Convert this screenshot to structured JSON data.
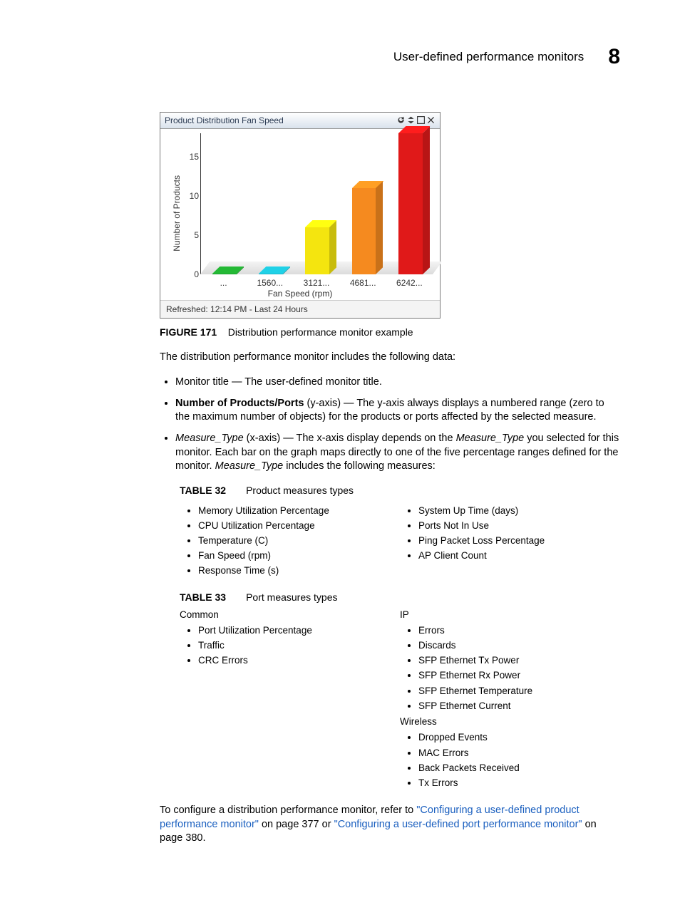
{
  "header": {
    "title": "User-defined performance monitors",
    "chapter": "8"
  },
  "panel": {
    "title": "Product Distribution Fan Speed",
    "footer": "Refreshed: 12:14 PM -  Last 24 Hours",
    "ylabel": "Number of Products",
    "xlabel": "Fan Speed (rpm)",
    "yticks": [
      "0",
      "5",
      "10",
      "15"
    ],
    "xticks": [
      "...",
      "1560...",
      "3121...",
      "4681...",
      "6242..."
    ],
    "icons": [
      "refresh-icon",
      "collapse-icon",
      "maximize-icon",
      "close-icon"
    ]
  },
  "chart_data": {
    "type": "bar",
    "title": "Product Distribution Fan Speed",
    "xlabel": "Fan Speed (rpm)",
    "ylabel": "Number of Products",
    "ylim": [
      0,
      18
    ],
    "categories": [
      "...",
      "1560...",
      "3121...",
      "4681...",
      "6242..."
    ],
    "values": [
      0,
      0,
      6,
      11,
      18
    ],
    "colors": [
      "#1fa12e",
      "#1bb6c9",
      "#f4e50f",
      "#f58a1f",
      "#e01919"
    ]
  },
  "figure": {
    "label": "FIGURE 171",
    "title": "Distribution performance monitor example"
  },
  "para_intro": "The distribution performance monitor includes the following data:",
  "bullets": {
    "b1_lead": "Monitor title — ",
    "b1_rest": "The user-defined monitor title.",
    "b2_lead_strong": "Number of Products/Ports",
    "b2_lead_plain": " (y-axis) — ",
    "b2_rest": "The y-axis always displays a numbered range (zero to the maximum number of objects) for the products or ports affected by the selected measure.",
    "b3_lead_em": "Measure_Type",
    "b3_mid1": " (x-axis) — The x-axis display depends on the ",
    "b3_em2": "Measure_Type",
    "b3_mid2": " you selected for this monitor. Each bar on the graph maps directly to one of the five percentage ranges defined for the monitor. ",
    "b3_em3": "Measure_Type",
    "b3_rest": " includes the following measures:"
  },
  "table32": {
    "label": "TABLE 32",
    "title": "Product measures types",
    "left": [
      "Memory Utilization Percentage",
      "CPU Utilization Percentage",
      "Temperature (C)",
      "Fan Speed (rpm)",
      "Response Time (s)"
    ],
    "right": [
      "System Up Time (days)",
      "Ports Not In Use",
      "Ping Packet Loss Percentage",
      "AP Client Count"
    ]
  },
  "table33": {
    "label": "TABLE 33",
    "title": "Port measures types",
    "left_head": "Common",
    "left": [
      "Port Utilization Percentage",
      "Traffic",
      "CRC Errors"
    ],
    "right_head1": "IP",
    "right1": [
      "Errors",
      "Discards",
      "SFP Ethernet Tx Power",
      "SFP Ethernet Rx Power",
      "SFP Ethernet Temperature",
      "SFP Ethernet Current"
    ],
    "right_head2": "Wireless",
    "right2": [
      "Dropped Events",
      "MAC Errors",
      "Back Packets Received",
      "Tx Errors"
    ]
  },
  "closing": {
    "pre": "To configure a distribution performance monitor, refer to ",
    "link1": "\"Configuring a user-defined product performance monitor\"",
    "mid1": " on page 377 or ",
    "link2": "\"Configuring a user-defined port performance monitor\"",
    "post": " on page 380."
  }
}
